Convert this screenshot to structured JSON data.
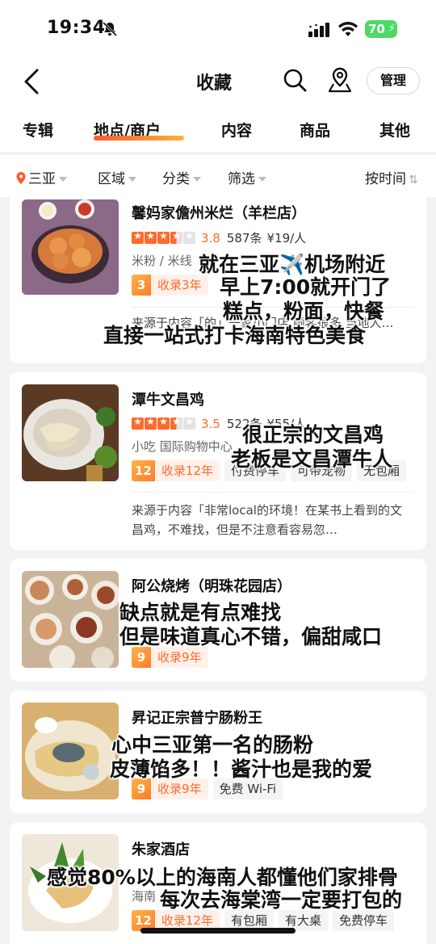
{
  "status": {
    "time": "19:34",
    "battery": "70"
  },
  "nav": {
    "title": "收藏",
    "manage": "管理"
  },
  "tabs": [
    {
      "label": "专辑"
    },
    {
      "label": "地点/商户",
      "active": true
    },
    {
      "label": "内容"
    },
    {
      "label": "商品"
    },
    {
      "label": "其他"
    }
  ],
  "filters": {
    "city": "三亚",
    "area": "区域",
    "category": "分类",
    "screen": "筛选",
    "sort": "按时间"
  },
  "cards": [
    {
      "title": "馨妈家儋州米烂（羊栏店）",
      "score": "3.8",
      "count": "587条",
      "price": "¥19/人",
      "sub": "米粉 / 米线",
      "collect_num": "3",
      "collect_label": "收录3年",
      "source": "来源于内容「的」一家小门店 顾客很多 当地人…"
    },
    {
      "title": "潭牛文昌鸡",
      "score": "3.5",
      "count": "522条",
      "price": "¥55/人",
      "sub": "小吃  国际购物中心",
      "collect_num": "12",
      "collect_label": "收录12年",
      "tags": [
        "付费停车",
        "可带宠物",
        "无包厢"
      ],
      "source": "来源于内容「非常local的环境！在某书上看到的文昌鸡，不难找，但是不注意看容易忽…"
    },
    {
      "title": "阿公烧烤（明珠花园店）",
      "collect_num": "9",
      "collect_label": "收录9年"
    },
    {
      "title": "昇记正宗普宁肠粉王",
      "collect_num": "9",
      "collect_label": "收录9年",
      "tags": [
        "免费 Wi-Fi"
      ]
    },
    {
      "title": "朱家酒店",
      "sub": "海南",
      "collect_num": "12",
      "collect_label": "收录12年",
      "tags": [
        "有包厢",
        "有大桌",
        "免费停车"
      ]
    }
  ],
  "overlays": {
    "card1": [
      "就在三亚✈️机场附近",
      "早上7:00就开门了",
      "糕点，粉面，快餐",
      "直接一站式打卡海南特色美食"
    ],
    "card2": [
      "很正宗的文昌鸡",
      "老板是文昌潭牛人"
    ],
    "card3": [
      "缺点就是有点难找",
      "但是味道真心不错，偏甜咸口"
    ],
    "card4": [
      "心中三亚第一名的肠粉",
      "皮薄馅多！！酱汁也是我的爱"
    ],
    "card5": [
      "感觉80%以上的海南人都懂他们家排骨",
      "每次去海棠湾一定要打包的"
    ]
  }
}
